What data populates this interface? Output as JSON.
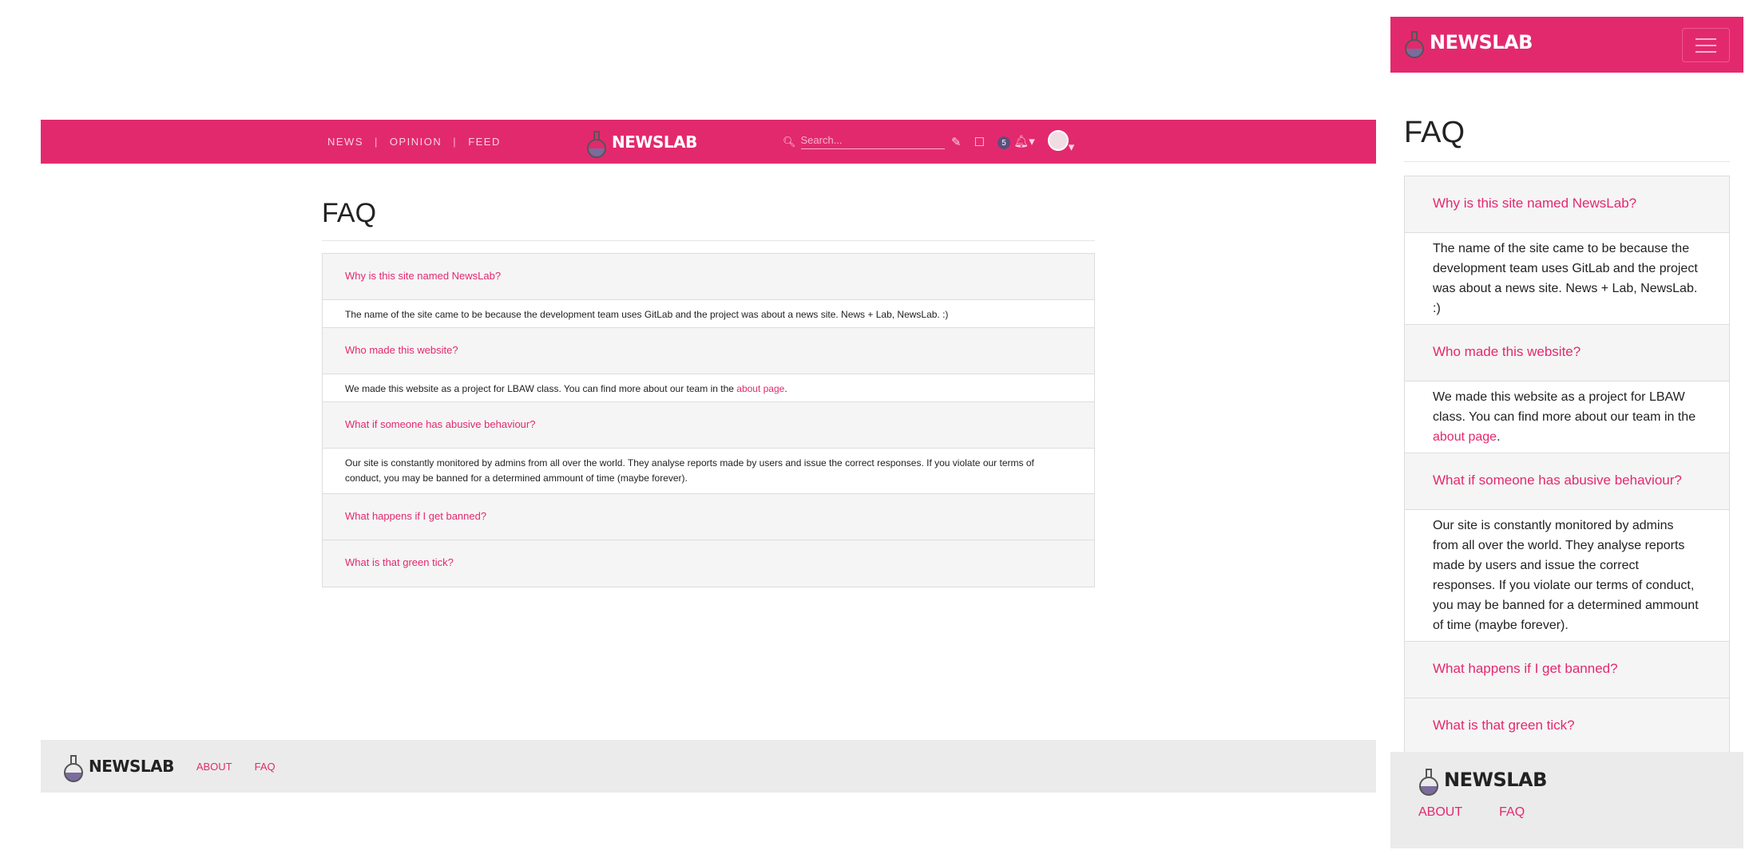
{
  "brand": "NEWSLAB",
  "nav": {
    "links": [
      "NEWS",
      "OPINION",
      "FEED"
    ],
    "search_placeholder": "Search...",
    "notification_count": "5"
  },
  "page_title": "FAQ",
  "faq": [
    {
      "q": "Why is this site named NewsLab?",
      "a": "The name of the site came to be because the development team uses GitLab and the project was about a news site. News + Lab, NewsLab. :)"
    },
    {
      "q": "Who made this website?",
      "a": "We made this website as a project for LBAW class. You can find more about our team in the ",
      "link": "about page",
      "a_end": "."
    },
    {
      "q": "What if someone has abusive behaviour?",
      "a": "Our site is constantly monitored by admins from all over the world. They analyse reports made by users and issue the correct responses. If you violate our terms of conduct, you may be banned for a determined ammount of time (maybe forever)."
    },
    {
      "q": "What happens if I get banned?"
    },
    {
      "q": "What is that green tick?"
    }
  ],
  "footer": {
    "about": "ABOUT",
    "faq": "FAQ"
  },
  "colors": {
    "accent": "#e3296e",
    "footer_bg": "#ebebeb"
  }
}
